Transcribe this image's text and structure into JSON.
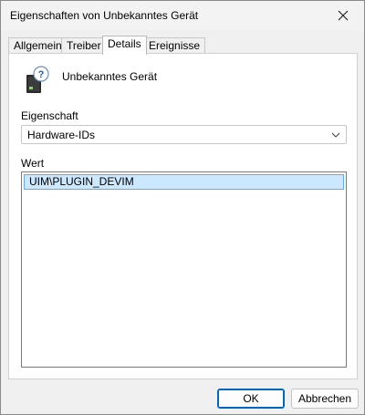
{
  "window": {
    "title": "Eigenschaften von Unbekanntes Gerät",
    "close_icon": "close-icon"
  },
  "tabs": [
    {
      "label": "Allgemein",
      "active": false
    },
    {
      "label": "Treiber",
      "active": false
    },
    {
      "label": "Details",
      "active": true
    },
    {
      "label": "Ereignisse",
      "active": false
    }
  ],
  "device": {
    "icon": "unknown-device-icon",
    "name": "Unbekanntes Gerät"
  },
  "property": {
    "label": "Eigenschaft",
    "selected": "Hardware-IDs"
  },
  "value": {
    "label": "Wert",
    "items": [
      "UIM\\PLUGIN_DEVIM"
    ]
  },
  "buttons": {
    "ok": "OK",
    "cancel": "Abbrechen"
  },
  "colors": {
    "selection_bg": "#cce8ff",
    "selection_border": "#6aa9de",
    "accent": "#0067c0"
  }
}
